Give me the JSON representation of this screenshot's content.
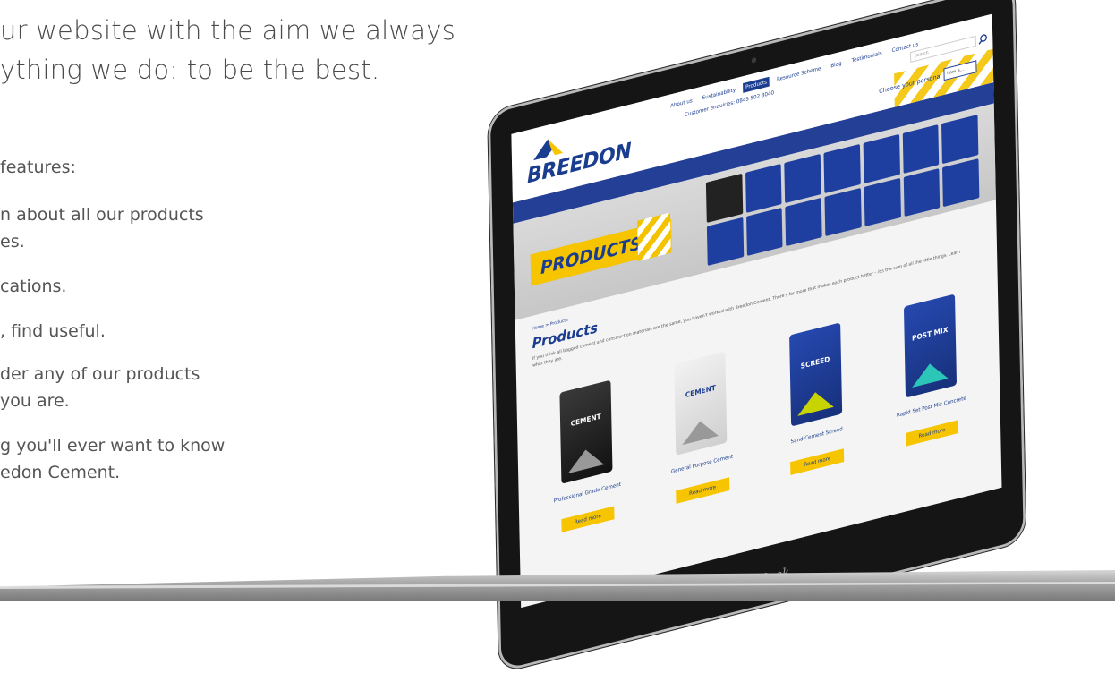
{
  "intro": {
    "line1": "ur website with the aim we always",
    "line2": "ything we do: to be the best."
  },
  "features": {
    "title": "features:",
    "items": [
      "n about all our products",
      "es.",
      "cations.",
      ", find useful.",
      "der any of our products",
      "you are.",
      "g you'll ever want to know",
      "edon Cement."
    ]
  },
  "device": {
    "brand": "MacBook"
  },
  "site": {
    "logo": "BREEDON",
    "nav": [
      "About us",
      "Sustainability",
      "Products",
      "Resource Scheme",
      "Blog",
      "Testimonials",
      "Contact us"
    ],
    "nav_active_index": 2,
    "search_placeholder": "Search",
    "phone": "Customer enquiries: 0845 502 8040",
    "persona_label": "Choose your persona:",
    "persona_value": "I am a...",
    "hero_label": "PRODUCTS",
    "breadcrumb": "Home > Products",
    "page_title": "Products",
    "description": "If you think all bagged cement and construction materials are the same, you haven't worked with Breedon Cement. There's far more that makes each product better – it's the sum of all the little things. Learn what they are.",
    "products": [
      {
        "bag_label": "CEMENT",
        "name": "Professional Grade Cement",
        "button": "Read more",
        "style": "cement"
      },
      {
        "bag_label": "CEMENT",
        "name": "General Purpose Cement",
        "button": "Read more",
        "style": "general"
      },
      {
        "bag_label": "SCREED",
        "name": "Sand Cement Screed",
        "button": "Read more",
        "style": "screed"
      },
      {
        "bag_label": "POST MIX",
        "name": "Rapid Set Post Mix Concrete",
        "button": "Read more",
        "style": "post"
      }
    ]
  },
  "colors": {
    "brand_blue": "#1b3d8f",
    "brand_yellow": "#f6c500"
  }
}
